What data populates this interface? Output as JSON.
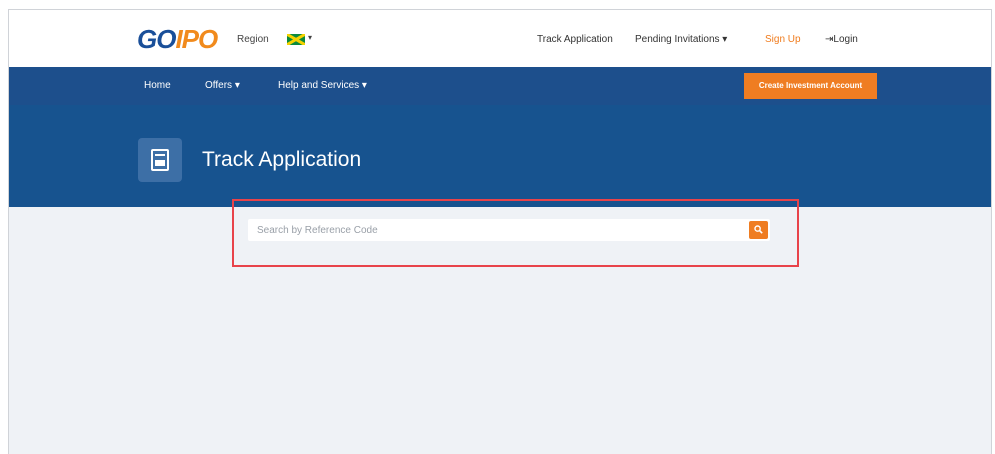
{
  "header": {
    "logo_go": "GO",
    "logo_ipo": "IPO",
    "region_label": "Region",
    "region_caret": "▾",
    "links": {
      "track_application": "Track Application",
      "pending_invitations": "Pending Invitations ▾",
      "sign_up": "Sign Up",
      "login": "⇥Login"
    }
  },
  "navbar": {
    "items": [
      {
        "label": "Home"
      },
      {
        "label": "Offers ▾"
      },
      {
        "label": "Help and Services ▾"
      }
    ],
    "cta_label": "Create Investment Account"
  },
  "hero": {
    "title": "Track Application",
    "icon": "document-icon"
  },
  "search": {
    "placeholder": "Search by Reference Code",
    "value": "",
    "button_icon": "search-icon"
  },
  "colors": {
    "brand_blue": "#1d4f8c",
    "hero_blue": "#17538f",
    "accent_orange": "#ef7d22",
    "highlight_red": "#e8434a",
    "page_bg": "#eff2f6"
  }
}
